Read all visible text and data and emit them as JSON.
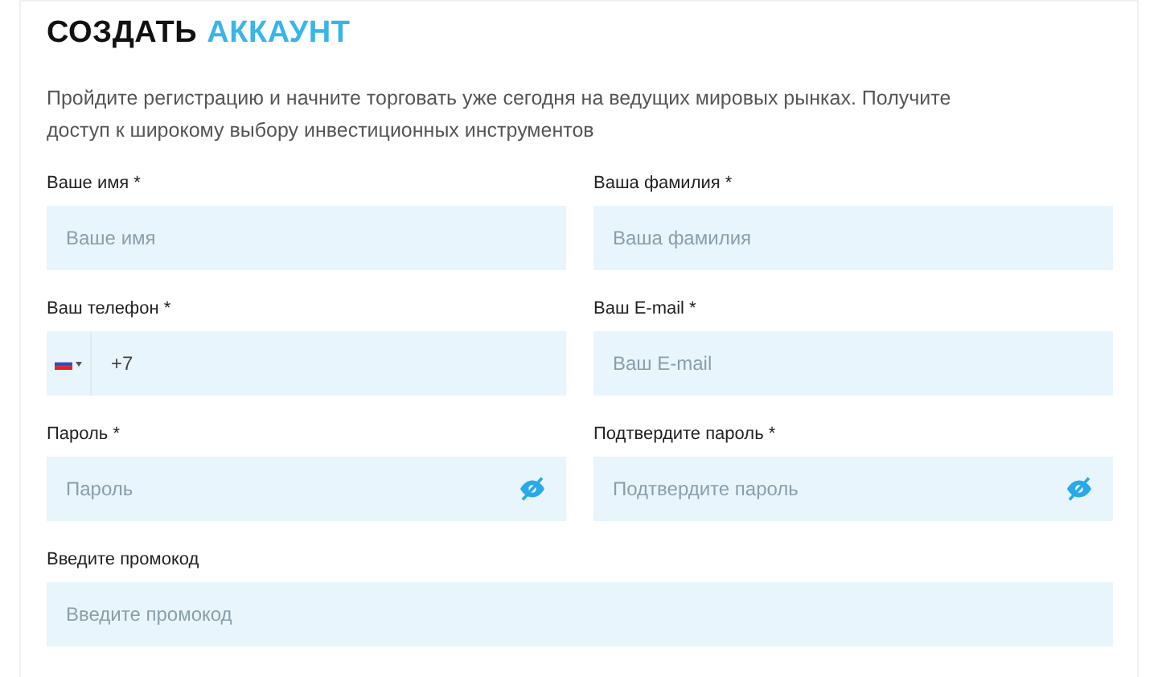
{
  "title": {
    "main": "СОЗДАТЬ",
    "accent": "АККАУНТ"
  },
  "intro": "Пройдите регистрацию и начните торговать уже сегодня на ведущих мировых рынках. Получите доступ к широкому выбору инвестиционных инструментов",
  "fields": [
    {
      "kind": "text",
      "label": "Ваше имя *",
      "placeholder": "Ваше имя",
      "wide": false
    },
    {
      "kind": "text",
      "label": "Ваша фамилия *",
      "placeholder": "Ваша фамилия",
      "wide": false
    },
    {
      "kind": "phone",
      "label": "Ваш телефон *",
      "value": "+7",
      "wide": false
    },
    {
      "kind": "text",
      "label": "Ваш E-mail *",
      "placeholder": "Ваш E-mail",
      "wide": false
    },
    {
      "kind": "password",
      "label": "Пароль *",
      "placeholder": "Пароль",
      "wide": false
    },
    {
      "kind": "password",
      "label": "Подтвердите пароль *",
      "placeholder": "Подтвердите пароль",
      "wide": false
    },
    {
      "kind": "text",
      "label": "Введите промокод",
      "placeholder": "Введите промокод",
      "wide": true
    }
  ]
}
